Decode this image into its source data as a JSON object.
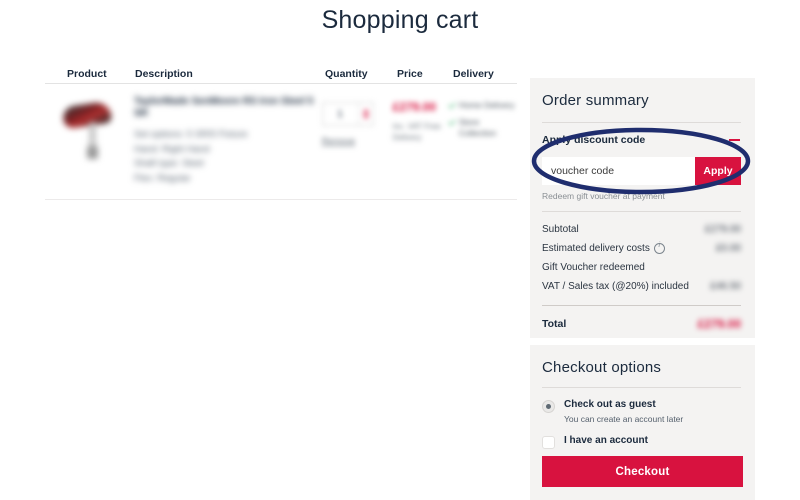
{
  "page": {
    "title": "Shopping cart"
  },
  "cart": {
    "columns": [
      {
        "key": "product",
        "label": "Product"
      },
      {
        "key": "desc",
        "label": "Description"
      },
      {
        "key": "qty",
        "label": "Quantity"
      },
      {
        "key": "price",
        "label": "Price"
      },
      {
        "key": "delivery",
        "label": "Delivery"
      }
    ],
    "rows": [
      {
        "image_alt": "product-thumbnail",
        "title": "TaylorMade SenMoore RS Iron Steel 5 SR",
        "attributes": [
          "Set options: 5 SR/5 Fixture",
          "Hand: Right Hand",
          "Shaft type: Steel",
          "Flex: Regular"
        ],
        "quantity": "1",
        "remove_label": "Remove",
        "price": "£279.00",
        "price_note": "Inc. VAT\nFree Delivery",
        "delivery_options": [
          "Home Delivery",
          "Store Collection"
        ]
      }
    ]
  },
  "order_summary": {
    "title": "Order summary",
    "discount": {
      "label": "Apply discount code",
      "toggle_icon": "minus-icon",
      "input_value": "voucher code",
      "input_placeholder": "voucher code",
      "apply_label": "Apply",
      "note": "Redeem gift voucher at payment"
    },
    "lines": [
      {
        "label": "Subtotal",
        "value": "£279.00",
        "info": false
      },
      {
        "label": "Estimated delivery costs",
        "value": "£0.00",
        "info": true
      },
      {
        "label": "Gift Voucher redeemed",
        "value": "",
        "info": false
      },
      {
        "label": "VAT / Sales tax (@20%) included",
        "value": "£46.50",
        "info": false
      }
    ],
    "total": {
      "label": "Total",
      "value": "£279.00"
    }
  },
  "checkout_options": {
    "title": "Checkout options",
    "options": [
      {
        "label": "Check out as guest",
        "sub": "You can create an account later",
        "selected": true
      },
      {
        "label": "I have an account",
        "sub": "",
        "selected": false
      }
    ],
    "button_label": "Checkout"
  },
  "annotation": {
    "shape": "ellipse",
    "color": "#1f2d6e",
    "target": "voucher-code-input"
  },
  "colors": {
    "brand_red": "#d8123f",
    "panel_bg": "#f4f3f2",
    "text_dark": "#1b2a3d",
    "annotation_blue": "#1f2d6e",
    "check_green": "#35b06a"
  }
}
